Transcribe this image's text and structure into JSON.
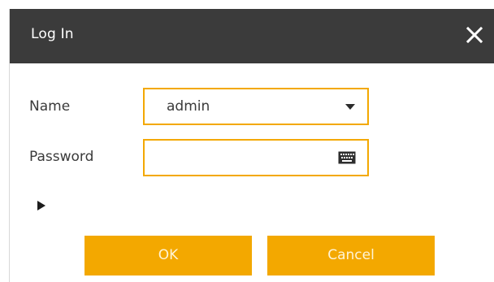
{
  "dialog": {
    "title": "Log In",
    "close_icon": "close-icon"
  },
  "form": {
    "name_label": "Name",
    "name_value": "admin",
    "password_label": "Password",
    "password_value": "",
    "dropdown_icon": "chevron-down-icon",
    "keyboard_icon": "keyboard-icon",
    "expand_icon": "play-triangle-icon"
  },
  "buttons": {
    "ok_label": "OK",
    "cancel_label": "Cancel"
  },
  "colors": {
    "titlebar": "#3b3b3b",
    "accent": "#f3a800",
    "button_text": "#fff4d6"
  }
}
